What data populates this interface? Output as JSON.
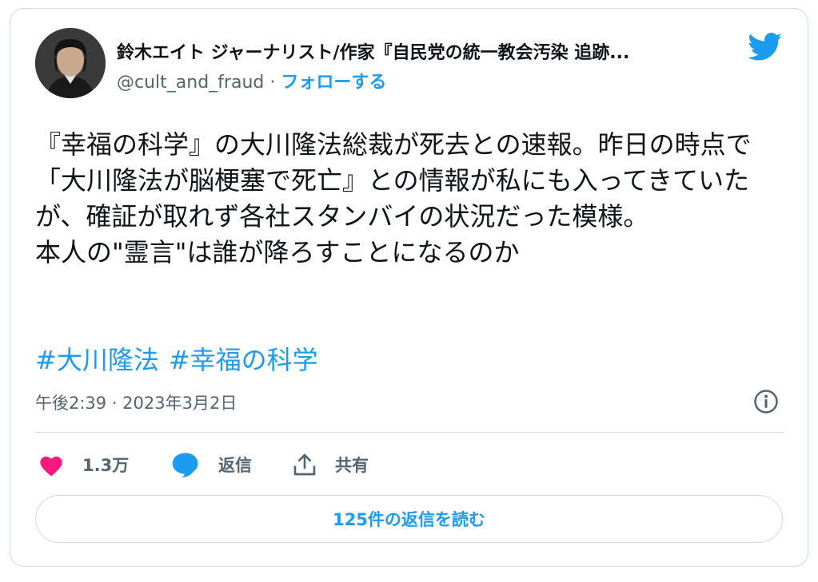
{
  "author": {
    "name": "鈴木エイト ジャーナリスト/作家『自民党の統一教会汚染 追跡...",
    "handle": "@cult_and_fraud",
    "separator": "·",
    "follow_label": "フォローする"
  },
  "tweet": {
    "text": "『幸福の科学』の大川隆法総裁が死去との速報。昨日の時点で「大川隆法が脳梗塞で死亡』との情報が私にも入ってきていたが、確証が取れず各社スタンバイの状況だった模様。\n本人の\"霊言\"は誰が降ろすことになるのか",
    "hashtags": [
      "#大川隆法",
      "#幸福の科学"
    ],
    "timestamp": "午後2:39 · 2023年3月2日"
  },
  "actions": {
    "like_count": "1.3万",
    "reply_label": "返信",
    "share_label": "共有"
  },
  "read_replies_label": "125件の返信を読む",
  "icons": {
    "brand": "twitter-bird-icon",
    "info": "info-icon",
    "like": "heart-icon",
    "reply": "speech-bubble-icon",
    "share": "share-icon"
  },
  "colors": {
    "accent": "#1d9bf0",
    "like": "#f91880",
    "secondary_text": "#536471",
    "border": "#cfd9de"
  }
}
